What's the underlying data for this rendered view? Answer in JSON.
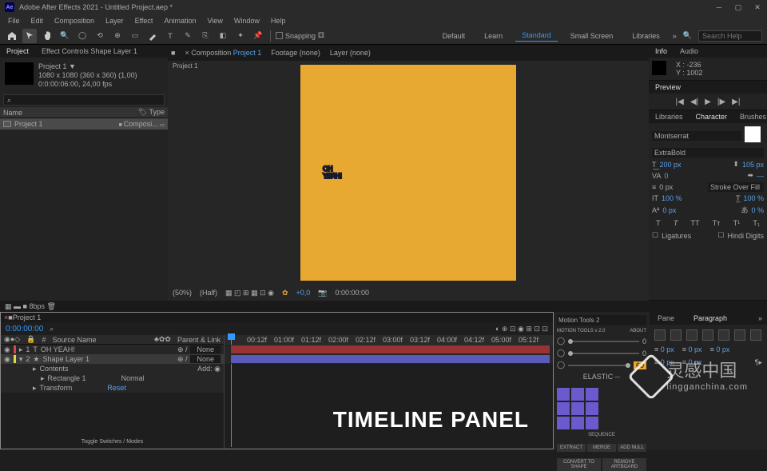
{
  "titlebar": {
    "app": "Ae",
    "title": "Adobe After Effects 2021 - Untitled Project.aep *"
  },
  "menubar": [
    "File",
    "Edit",
    "Composition",
    "Layer",
    "Effect",
    "Animation",
    "View",
    "Window",
    "Help"
  ],
  "toolbar": {
    "snapping": "Snapping"
  },
  "workspaces": {
    "items": [
      "Default",
      "Learn",
      "Standard",
      "Small Screen",
      "Libraries"
    ],
    "active": "Standard"
  },
  "search": {
    "placeholder": "Search Help"
  },
  "project": {
    "tab1": "Project",
    "tab2": "Effect Controls Shape Layer 1",
    "comp_name": "Project 1 ▼",
    "comp_info": "1080 x 1080 (360 x 360) (1,00)",
    "comp_time": "0:0:00:06:00, 24,00 fps",
    "col_name": "Name",
    "col_type": "Type",
    "item": "Project 1",
    "item_type": "Composi..."
  },
  "composition": {
    "tab_prefix": "Composition",
    "tab_name": "Project 1",
    "tab2": "Footage (none)",
    "tab3": "Layer (none)",
    "bc": "Project 1",
    "text_line1": "OH",
    "text_line2": "YEAH!",
    "zoom": "(50%)",
    "res": "(Half)",
    "exposure": "+0,0",
    "time": "0:00:00:00"
  },
  "right": {
    "info_tab": "Info",
    "audio_tab": "Audio",
    "info_x": "X : -236",
    "info_y": "Y : 1002",
    "preview_tab": "Preview",
    "lib_tab": "Libraries",
    "char_tab": "Character",
    "brush_tab": "Brushes",
    "font": "Montserrat",
    "weight": "ExtraBold",
    "size": "200 px",
    "leading": "105 px",
    "kerning": "0",
    "tracking": "0",
    "stroke_mode": "Stroke Over Fill",
    "scale_v": "100 %",
    "scale_h": "100 %",
    "baseline": "0 px",
    "tsume": "0 %",
    "ligatures": "Ligatures",
    "hindi": "Hindi Digits",
    "para_tab": "Paragraph",
    "pane_tab": "Pane"
  },
  "timeline": {
    "tab": "Project 1",
    "timecode": "0:00:00:00",
    "col_source": "Source Name",
    "col_parent": "Parent & Link",
    "ruler": [
      "00:12f",
      "01:00f",
      "01:12f",
      "02:00f",
      "02:12f",
      "03:00f",
      "03:12f",
      "04:00f",
      "04:12f",
      "05:00f",
      "05:12f"
    ],
    "layer1": {
      "num": "1",
      "name": "OH YEAH!",
      "parent": "None"
    },
    "layer2": {
      "num": "2",
      "name": "Shape Layer 1",
      "parent": "None"
    },
    "contents": "Contents",
    "add": "Add:",
    "rect": "Rectangle 1",
    "transform": "Transform",
    "mode": "Normal",
    "reset": "Reset",
    "footer": "Toggle Switches / Modes",
    "label": "TIMELINE PANEL"
  },
  "mt": {
    "tab": "Motion Tools 2",
    "brand": "MOTION TOOLS v 2.0",
    "about": "ABOUT",
    "elastic": "ELASTIC",
    "sequence": "SEQUENCE",
    "extract": "EXTRACT",
    "merge": "MERGE",
    "addnull": "ADD NULL",
    "cts": "CONVERT TO SHAPE",
    "ra": "REMOVE ARTBOARD"
  },
  "watermark": {
    "text": "灵感中国",
    "url": "lingganchina.com"
  }
}
